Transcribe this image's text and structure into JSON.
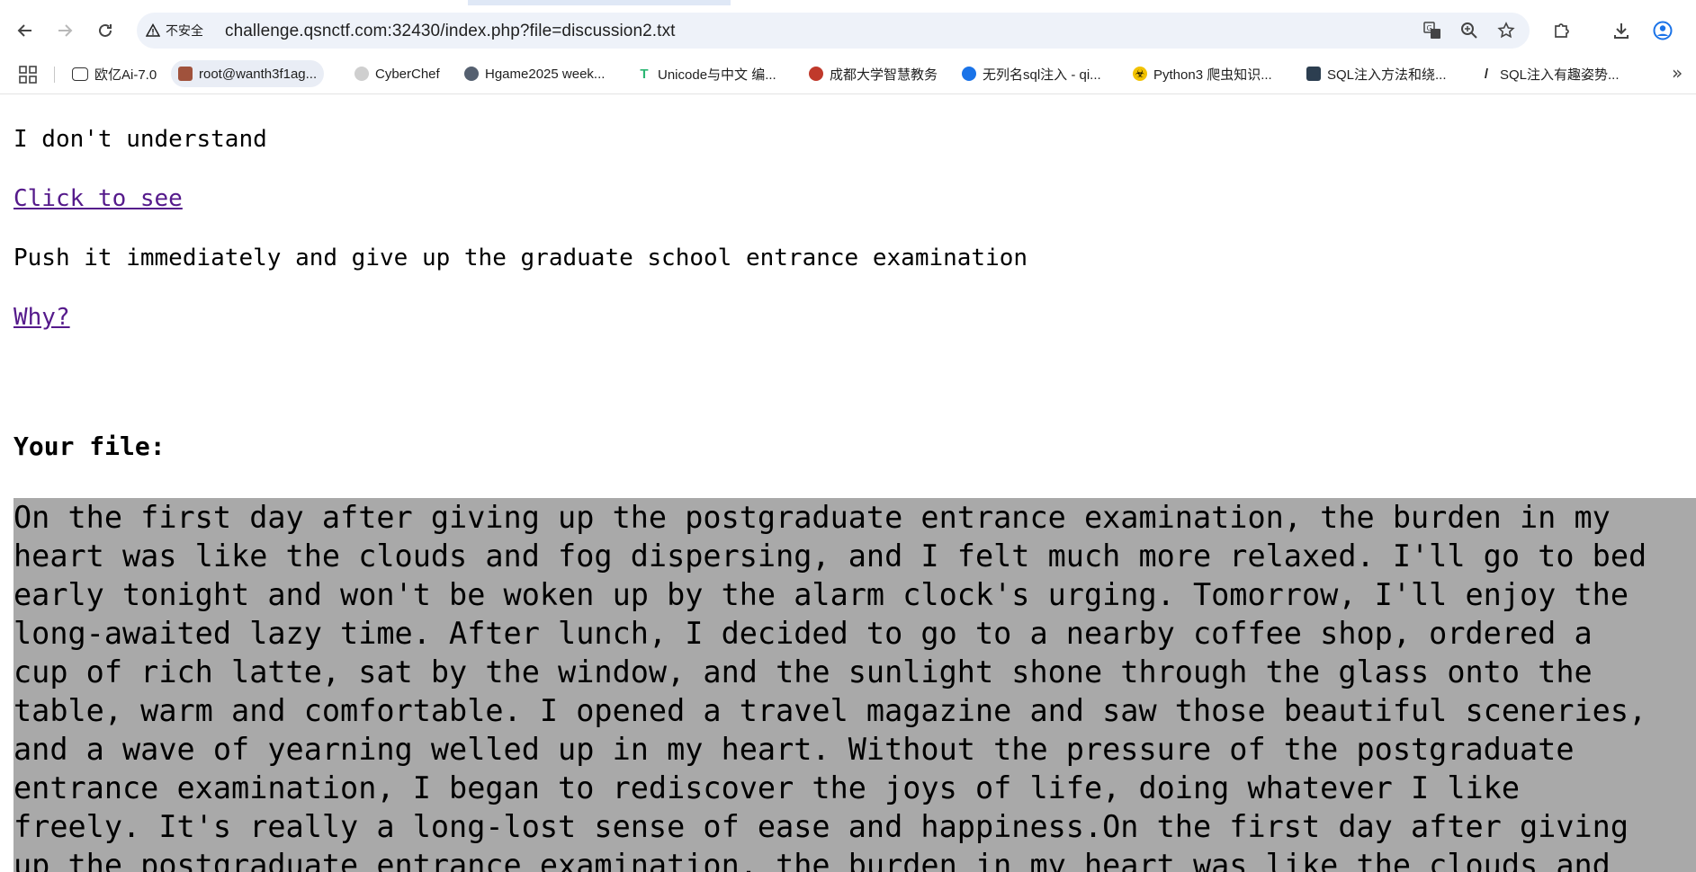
{
  "browser": {
    "security_label": "不安全",
    "url": "challenge.qsnctf.com:32430/index.php?file=discussion2.txt",
    "bookmarks": [
      {
        "label": "欧亿Ai-7.0",
        "icon": "discord-icon"
      },
      {
        "label": "root@wanth3f1ag...",
        "icon": "avatar-icon"
      },
      {
        "label": "CyberChef",
        "icon": "chef-hat-icon"
      },
      {
        "label": "Hgame2025 week...",
        "icon": "avatar-icon"
      },
      {
        "label": "Unicode与中文 编...",
        "icon": "t-logo-icon"
      },
      {
        "label": "成都大学智慧教务",
        "icon": "university-icon"
      },
      {
        "label": "无列名sql注入 - qi...",
        "icon": "circle-logo-icon"
      },
      {
        "label": "Python3 爬虫知识...",
        "icon": "biohazard-icon"
      },
      {
        "label": "SQL注入方法和绕...",
        "icon": "image-icon"
      },
      {
        "label": "SQL注入有趣姿势...",
        "icon": "slash-logo-icon"
      }
    ]
  },
  "page": {
    "line1": "I don't understand",
    "link1": "Click to see",
    "line2": "Push it immediately and give up the graduate school entrance examination",
    "link2": "Why?",
    "heading": "Your file:",
    "file_lines": [
      "On the first day after giving up the postgraduate entrance examination, the burden in my",
      "heart was like the clouds and fog dispersing, and I felt much more relaxed. I'll go to bed",
      "early tonight and won't be woken up by the alarm clock's urging. Tomorrow, I'll enjoy the",
      "long-awaited lazy time. After lunch, I decided to go to a nearby coffee shop, ordered a",
      "cup of rich latte, sat by the window, and the sunlight shone through the glass onto the",
      "table, warm and comfortable. I opened a travel magazine and saw those beautiful sceneries,",
      "and a wave of yearning welled up in my heart. Without the pressure of the postgraduate",
      "entrance examination, I began to rediscover the joys of life, doing whatever I like",
      "freely. It's really a long-lost sense of ease and happiness.On the first day after giving",
      "up the postgraduate entrance examination, the burden in my heart was like the clouds and"
    ]
  },
  "colors": {
    "visited_link": "#551a8b",
    "file_highlight": "#a9a9a9",
    "omnibox_bg": "#eef2f9"
  }
}
